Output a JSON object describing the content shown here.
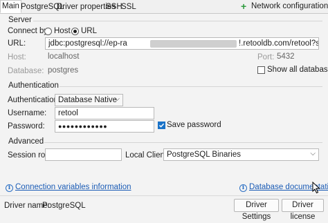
{
  "tabs": [
    {
      "label": "Main",
      "active": true
    },
    {
      "label": "PostgreSQL",
      "active": false
    },
    {
      "label": "Driver properties",
      "active": false
    },
    {
      "label": "SSH",
      "active": false
    },
    {
      "label": "SSL",
      "active": false
    }
  ],
  "network_button": {
    "icon": "plus-icon",
    "label": "Network configurations..."
  },
  "server": {
    "title": "Server",
    "connect_by_label": "Connect by:",
    "host_option": "Host",
    "url_option": "URL",
    "selected": "URL",
    "url_label": "URL:",
    "url_prefix": "jdbc:postgresql://ep-ra",
    "url_suffix": "!.retooldb.com/retool?sslmode=require",
    "host_label": "Host:",
    "host_value": "localhost",
    "port_label": "Port:",
    "port_value": "5432",
    "database_label": "Database:",
    "database_value": "postgres",
    "show_all_label": "Show all databases",
    "show_all_checked": false
  },
  "authentication": {
    "title": "Authentication",
    "auth_label": "Authentication:",
    "auth_value": "Database Native",
    "username_label": "Username:",
    "username_value": "retool",
    "password_label": "Password:",
    "password_value": "●●●●●●●●●●●●",
    "save_password_label": "Save password",
    "save_password_checked": true
  },
  "advanced": {
    "title": "Advanced",
    "session_role_label": "Session role:",
    "session_role_value": "",
    "local_client_label": "Local Client:",
    "local_client_value": "PostgreSQL Binaries"
  },
  "links": {
    "connection_vars": "Connection variables information",
    "database_docs": "Database documentati"
  },
  "footer": {
    "driver_name_label": "Driver name:",
    "driver_name_value": "PostgreSQL",
    "driver_settings_button": "Driver Settings",
    "driver_license_button": "Driver license"
  },
  "colors": {
    "accent": "#1a73c8",
    "link": "#1a5bb5",
    "plus_green": "#2e9b3e"
  }
}
